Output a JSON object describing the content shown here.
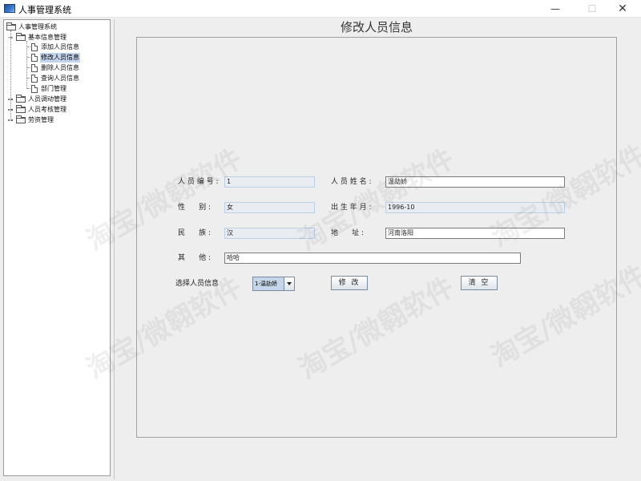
{
  "window": {
    "title": "人事管理系统",
    "minimize_glyph": "—",
    "maximize_glyph": "☐",
    "close_glyph": "✕"
  },
  "tree": {
    "root": "人事管理系统",
    "groups": [
      {
        "label": "基本信息管理",
        "expanded": true,
        "items": [
          "添加人员信息",
          "修改人员信息",
          "删除人员信息",
          "查询人员信息",
          "部门管理"
        ]
      },
      {
        "label": "人员调动管理",
        "expanded": false
      },
      {
        "label": "人员考核管理",
        "expanded": false
      },
      {
        "label": "劳资管理",
        "expanded": false
      }
    ],
    "selected": "修改人员信息"
  },
  "form": {
    "title": "修改人员信息",
    "fields": {
      "id": {
        "label": "人 员 编 号 :",
        "value": "1"
      },
      "name": {
        "label": "人 员 姓 名 :",
        "value": "温劼娇"
      },
      "gender": {
        "label": "性      别 :",
        "value": "女"
      },
      "birth": {
        "label": "出 生 年 月 :",
        "value": "1996-10"
      },
      "ethnicity": {
        "label": "民      族 :",
        "value": "汉"
      },
      "address": {
        "label": "地      址 :",
        "value": "河南洛阳"
      },
      "other": {
        "label": "其      他 :",
        "value": "哈哈"
      }
    },
    "select": {
      "label": "选择人员信息",
      "value": "1-温劼娇"
    },
    "buttons": {
      "modify": "修 改",
      "clear": "清 空"
    }
  },
  "watermark": "淘宝/微翱软件",
  "colors": {
    "selected_tree_bg": "#c3d5ee",
    "readonly_field_bg": "#e9ecf1",
    "panel_bg": "#eeeeee"
  }
}
